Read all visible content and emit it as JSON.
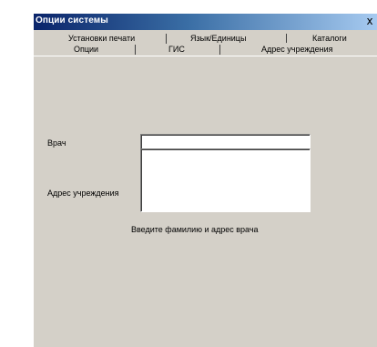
{
  "window": {
    "title": "Опции системы",
    "close_glyph": "x"
  },
  "tabs": {
    "back_row": [
      {
        "label": "Установки печати"
      },
      {
        "label": "Язык/Единицы"
      },
      {
        "label": "Каталоги"
      }
    ],
    "front_row": [
      {
        "label": "Опции"
      },
      {
        "label": "ГИС"
      },
      {
        "label": "Адрес учреждения",
        "active": true
      }
    ]
  },
  "form": {
    "doctor_label": "Врач",
    "doctor_value": "",
    "address_label": "Адрес учреждения",
    "address_value": "",
    "hint": "Введите фамилию и адрес врача"
  },
  "colors": {
    "title_gradient_start": "#0a246a",
    "title_gradient_end": "#a6caf0",
    "dialog_face": "#d4d0c8"
  }
}
